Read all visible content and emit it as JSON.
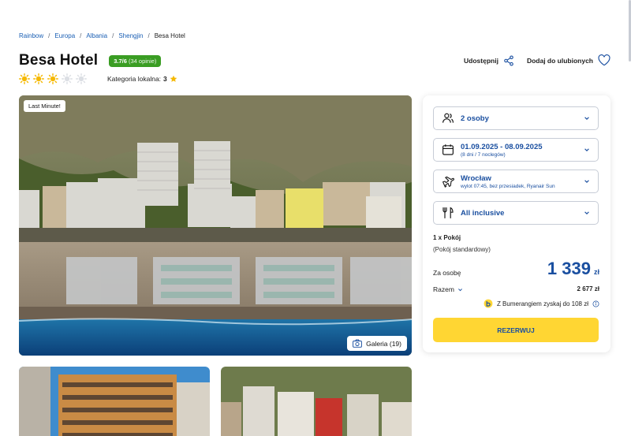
{
  "breadcrumb": {
    "items": [
      "Rainbow",
      "Europa",
      "Albania",
      "Shengjin"
    ],
    "separator": "/",
    "current": "Besa Hotel"
  },
  "hotel": {
    "name": "Besa Hotel",
    "rating_score": "3.7/6",
    "rating_opinions": "(34 opinie)",
    "suns_filled": 3,
    "suns_total": 5,
    "local_category_label": "Kategoria lokalna:",
    "local_category_value": "3"
  },
  "actions": {
    "share_label": "Udostępnij",
    "favorite_label": "Dodaj do ulubionych"
  },
  "photo": {
    "tag": "Last Minute!",
    "gallery_label": "Galeria (19)"
  },
  "booking": {
    "persons": "2 osoby",
    "dates": "01.09.2025 - 08.09.2025",
    "dates_sub": "(8 dni / 7 noclegów)",
    "departure": "Wrocław",
    "departure_sub": "wylot 07:45, bez przesiadek, Ryanair Sun",
    "board": "All inclusive",
    "room_count": "1 x Pokój",
    "room_type": "(Pokój standardowy)",
    "per_person_label": "Za osobę",
    "price": "1 339",
    "currency": "zł",
    "total_label": "Razem",
    "total_value": "2 677 zł",
    "bumerang_text": "Z Bumerangiem zyskaj do 108 zł",
    "reserve_label": "REZERWUJ"
  },
  "colors": {
    "brand_blue": "#1a4fa0",
    "rating_green": "#3a9d23",
    "reserve_yellow": "#ffd633",
    "sun_yellow": "#f5b800"
  },
  "icons": [
    "share-icon",
    "heart-icon",
    "camera-icon",
    "persons-icon",
    "calendar-icon",
    "plane-icon",
    "cutlery-icon",
    "chevron-down-icon",
    "info-icon",
    "bumerang-logo",
    "sun-icon",
    "star-icon"
  ]
}
